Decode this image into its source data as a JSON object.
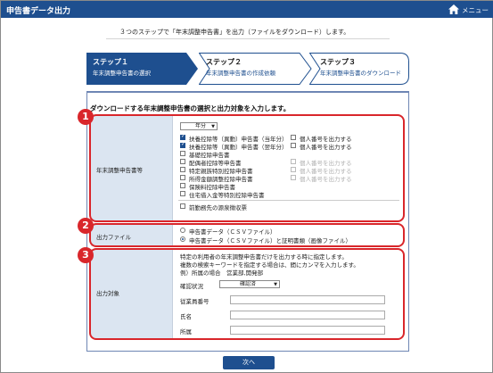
{
  "app": {
    "title": "申告書データ出力",
    "menu_label": "メニュー"
  },
  "intro": "３つのステップで「年末調整申告書」を出力（ファイルをダウンロード）します。",
  "steps": [
    {
      "title": "ステップ１",
      "desc": "年末調整申告書の選択",
      "active": true
    },
    {
      "title": "ステップ２",
      "desc": "年末調整申告書の作成依頼",
      "active": false
    },
    {
      "title": "ステップ３",
      "desc": "年末調整申告書のダウンロード",
      "active": false
    }
  ],
  "heading": "ダウンロードする年末調整申告書の選択と出力対象を入力します。",
  "section1": {
    "label": "年末調整申告書等",
    "year_select": "年分",
    "items": [
      {
        "label": "扶養控除等（異動）申告書（当年分）",
        "checked": true,
        "opt_label": "個人番号を出力する",
        "opt_checked": false,
        "opt_disabled": false
      },
      {
        "label": "扶養控除等（異動）申告書（翌年分）",
        "checked": true,
        "opt_label": "個人番号を出力する",
        "opt_checked": false,
        "opt_disabled": false
      },
      {
        "label": "基礎控除申告書",
        "checked": false
      },
      {
        "label": "配偶者控除等申告書",
        "checked": false,
        "opt_label": "個人番号を出力する",
        "opt_checked": false,
        "opt_disabled": true
      },
      {
        "label": "特定親族特別控除申告書",
        "checked": false,
        "opt_label": "個人番号を出力する",
        "opt_checked": false,
        "opt_disabled": true
      },
      {
        "label": "所得金額調整控除申告書",
        "checked": false,
        "opt_label": "個人番号を出力する",
        "opt_checked": false,
        "opt_disabled": true
      },
      {
        "label": "保険料控除申告書",
        "checked": false
      },
      {
        "label": "住宅借入金等特別控除申告書",
        "checked": false
      }
    ],
    "extra": "前勤務先の源泉徴収票"
  },
  "section2": {
    "label": "出力ファイル",
    "options": [
      {
        "label": "申告書データ（ＣＳＶファイル）",
        "selected": false
      },
      {
        "label": "申告書データ（ＣＳＶファイル）と証明書類（画像ファイル）",
        "selected": true
      }
    ]
  },
  "section3": {
    "label": "出力対象",
    "desc_lines": [
      "特定の利用者の年末調整申告書だけを出力する時に指定します。",
      "複数の検索キーワードを指定する場合は、間にカンマを入力します。",
      "例）所属の場合　営業部,開発部"
    ],
    "confirm_label": "確認状況",
    "confirm_value": "確認済",
    "employee_no_label": "従業員番号",
    "name_label": "氏名",
    "dept_label": "所属"
  },
  "badges": [
    "1",
    "2",
    "3"
  ],
  "next_button": "次へ",
  "colors": {
    "brand": "#1e4f8f",
    "highlight": "#d9262b",
    "label_bg": "#dbe5f1"
  }
}
